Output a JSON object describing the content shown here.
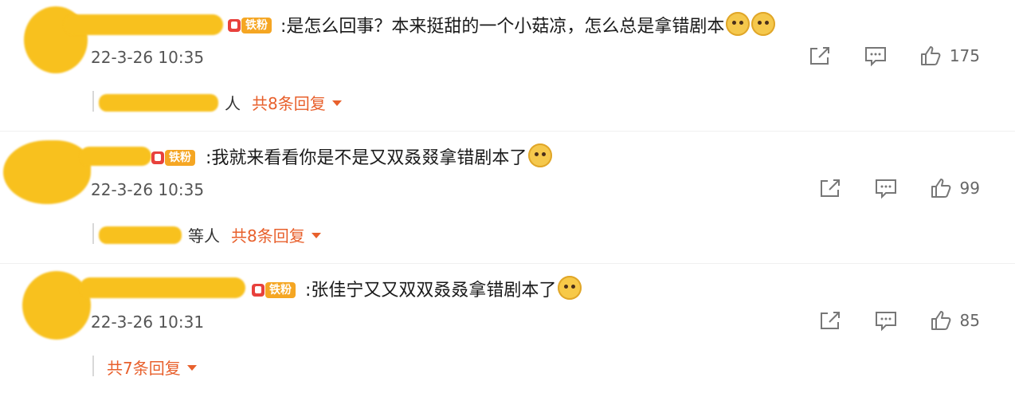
{
  "comments": [
    {
      "badge": "铁粉",
      "text": ":是怎么回事？本来挺甜的一个小菇凉，怎么总是拿错剧本",
      "time": "22-3-26 10:35",
      "likes": "175",
      "reply_users_suffix": "人",
      "reply_count": "共8条回复"
    },
    {
      "badge": "铁粉",
      "text": ":我就来看看你是不是又双叒叕拿错剧本了",
      "time": "22-3-26 10:35",
      "likes": "99",
      "reply_users_suffix": "等人",
      "reply_count": "共8条回复"
    },
    {
      "badge": "铁粉",
      "text": ":张佳宁又又双双叒叒拿错剧本了",
      "time": "22-3-26 10:31",
      "likes": "85",
      "reply_users_suffix": "",
      "reply_count": "共7条回复"
    }
  ],
  "icons": {
    "share": "share-icon",
    "comment": "comment-icon",
    "like": "thumbs-up-icon",
    "dropdown": "caret-down-icon"
  },
  "colors": {
    "accent": "#e8602c",
    "badge": "#f5a623",
    "redaction": "#f8c11e"
  }
}
